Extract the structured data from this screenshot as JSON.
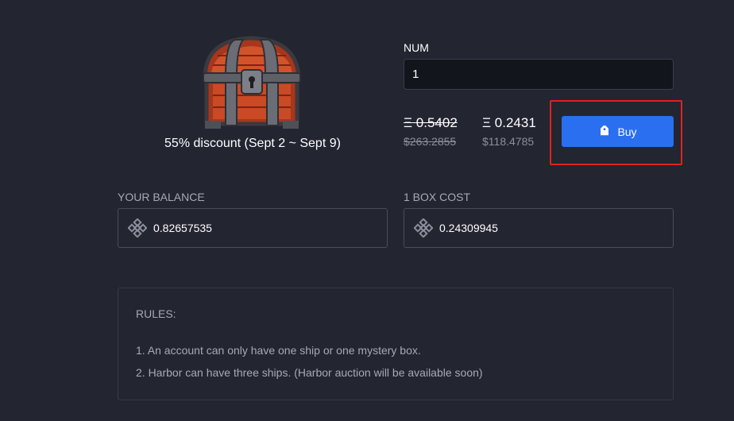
{
  "product": {
    "image_icon": "treasure-chest-icon",
    "discount_text": "55% discount (Sept 2 ~ Sept 9)"
  },
  "quantity": {
    "label": "NUM",
    "value": "1"
  },
  "pricing": {
    "original_eth": "Ξ 0.5402",
    "original_usd": "$263.2855",
    "discounted_eth": "Ξ 0.2431",
    "discounted_usd": "$118.4785"
  },
  "buy_button": {
    "label": "Buy",
    "icon": "tag-icon",
    "color": "#2a6ff0",
    "highlight_color": "#e02020"
  },
  "balance": {
    "label": "YOUR BALANCE",
    "value": "0.82657535",
    "icon": "bnb-icon"
  },
  "box_cost": {
    "label": "1 BOX COST",
    "value": "0.24309945",
    "icon": "bnb-icon"
  },
  "rules": {
    "title": "RULES:",
    "items": [
      "1. An account can only have one ship or one mystery box.",
      "2. Harbor can have three ships. (Harbor auction will be available soon)"
    ]
  }
}
